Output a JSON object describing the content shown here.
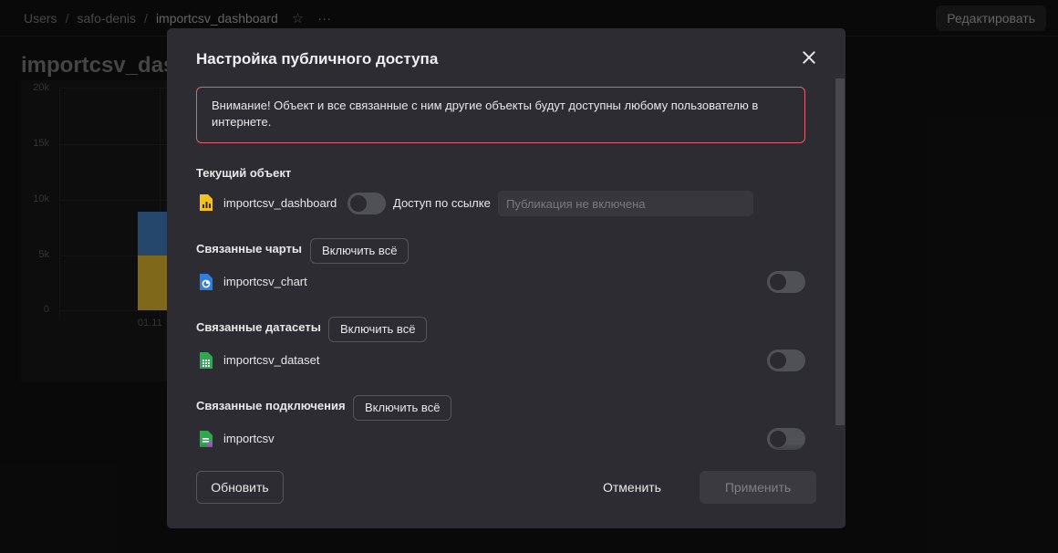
{
  "breadcrumbs": [
    "Users",
    "safo-denis",
    "importcsv_dashboard"
  ],
  "breadcrumb_separator": "/",
  "header": {
    "edit_label": "Редактировать",
    "star_icon": "star-icon",
    "more_icon": "more-icon"
  },
  "dashboard": {
    "title": "importcsv_das",
    "y_ticks": [
      "20k",
      "15k",
      "10k",
      "5k",
      "0"
    ],
    "x_tick": "01.11",
    "colors": {
      "bar_top": "#3a6ea5",
      "bar_bottom": "#c4a028"
    }
  },
  "modal": {
    "title": "Настройка публичного доступа",
    "warning": "Внимание! Объект и все связанные с ним другие объекты будут доступны любому пользователю в интернете.",
    "current": {
      "heading": "Текущий объект",
      "name": "importcsv_dashboard",
      "icon": "dashboard-icon",
      "toggle_on": false,
      "link_label": "Доступ по ссылке",
      "link_placeholder": "Публикация не включена"
    },
    "sections": [
      {
        "heading": "Связанные чарты",
        "button": "Включить всё",
        "item": "importcsv_chart",
        "icon": "chart-icon",
        "toggle_on": false
      },
      {
        "heading": "Связанные датасеты",
        "button": "Включить всё",
        "item": "importcsv_dataset",
        "icon": "dataset-icon",
        "toggle_on": false
      },
      {
        "heading": "Связанные подключения",
        "button": "Включить всё",
        "item": "importcsv",
        "icon": "connection-icon",
        "toggle_on": false
      }
    ],
    "footer": {
      "refresh": "Обновить",
      "cancel": "Отменить",
      "apply": "Применить"
    },
    "colors": {
      "warning_border": "#e0606b",
      "background": "#2d2c33"
    }
  }
}
